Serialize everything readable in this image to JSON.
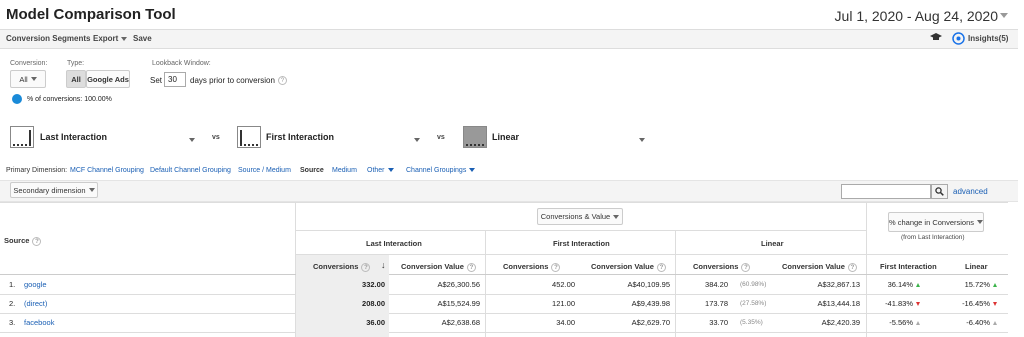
{
  "header": {
    "title": "Model Comparison Tool",
    "date_range": "Jul 1, 2020 - Aug 24, 2020"
  },
  "toolbar": {
    "conversion_segments": "Conversion Segments",
    "export": "Export",
    "save": "Save",
    "insights": "Insights(5)"
  },
  "controls": {
    "conversion_label": "Conversion:",
    "conversion_value": "All",
    "type_label": "Type:",
    "type_all": "All",
    "type_google_ads": "Google Ads",
    "lookback_label": "Lookback Window:",
    "lookback_set": "Set",
    "lookback_value": "30",
    "lookback_suffix": "days prior to conversion",
    "pct_conversions": "% of conversions: 100.00%"
  },
  "models": {
    "model1": "Last Interaction",
    "model2": "First Interaction",
    "model3": "Linear",
    "vs": "vs"
  },
  "primary_dimension": {
    "label": "Primary Dimension:",
    "mcf": "MCF Channel Grouping",
    "default": "Default Channel Grouping",
    "source_medium": "Source / Medium",
    "source": "Source",
    "medium": "Medium",
    "other": "Other",
    "channel_groupings": "Channel Groupings"
  },
  "secondary": {
    "label": "Secondary dimension",
    "search_placeholder": "",
    "advanced": "advanced"
  },
  "table": {
    "metric_select": "Conversions & Value",
    "pct_change_select": "% change in Conversions",
    "from_last": "(from Last Interaction)",
    "source_header": "Source",
    "group_last": "Last Interaction",
    "group_first": "First Interaction",
    "group_linear": "Linear",
    "col_conversions": "Conversions",
    "col_value": "Conversion Value",
    "col_first": "First Interaction",
    "col_linear": "Linear",
    "rows": [
      {
        "idx": "1.",
        "source": "google",
        "li_conv": "332.00",
        "li_val": "A$26,300.56",
        "fi_conv": "452.00",
        "fi_val": "A$40,109.95",
        "lin_conv": "384.20",
        "lin_pct": "(60.98%)",
        "lin_val": "A$32,867.13",
        "chg_first": "36.14%",
        "chg_linear": "15.72%"
      },
      {
        "idx": "2.",
        "source": "(direct)",
        "li_conv": "208.00",
        "li_val": "A$15,524.99",
        "fi_conv": "121.00",
        "fi_val": "A$9,439.98",
        "lin_conv": "173.78",
        "lin_pct": "(27.58%)",
        "lin_val": "A$13,444.18",
        "chg_first": "-41.83%",
        "chg_linear": "-16.45%"
      },
      {
        "idx": "3.",
        "source": "facebook",
        "li_conv": "36.00",
        "li_val": "A$2,638.68",
        "fi_conv": "34.00",
        "fi_val": "A$2,629.70",
        "lin_conv": "33.70",
        "lin_pct": "(5.35%)",
        "lin_val": "A$2,420.39",
        "chg_first": "-5.56%",
        "chg_linear": "-6.40%"
      }
    ]
  }
}
